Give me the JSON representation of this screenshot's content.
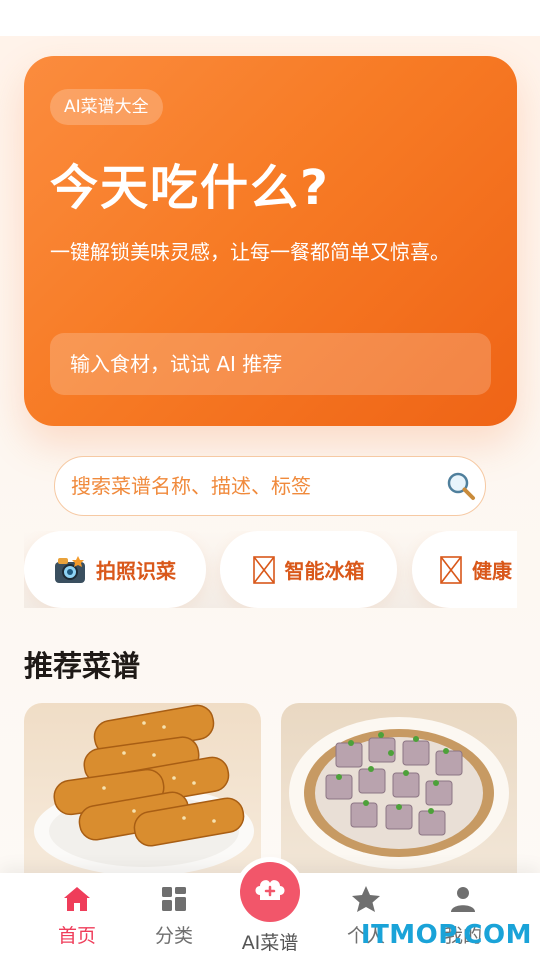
{
  "hero": {
    "badge": "AI菜谱大全",
    "title": "今天吃什么?",
    "description": "一键解锁美味灵感，让每一餐都简单又惊喜。",
    "input_placeholder": "输入食材，试试 AI 推荐"
  },
  "search": {
    "placeholder": "搜索菜谱名称、描述、标签",
    "icon": "search-icon"
  },
  "chips": [
    {
      "label": "拍照识菜",
      "icon": "camera-icon"
    },
    {
      "label": "智能冰箱",
      "icon": "broken-image-icon"
    },
    {
      "label": "健康",
      "icon": "broken-image-icon"
    }
  ],
  "section": {
    "recommended_title": "推荐菜谱"
  },
  "cards": [
    {
      "image": "sesame-pastry-rolls"
    },
    {
      "image": "taro-cubes-with-scallion"
    }
  ],
  "nav": {
    "home": "首页",
    "category": "分类",
    "ai": "AI菜谱",
    "personal": "个人",
    "mine": "我的"
  },
  "watermark": "ITMOP.COM",
  "colors": {
    "accent": "#f77b25",
    "nav_active": "#ef3d5a",
    "ai_button": "#f2566a"
  }
}
